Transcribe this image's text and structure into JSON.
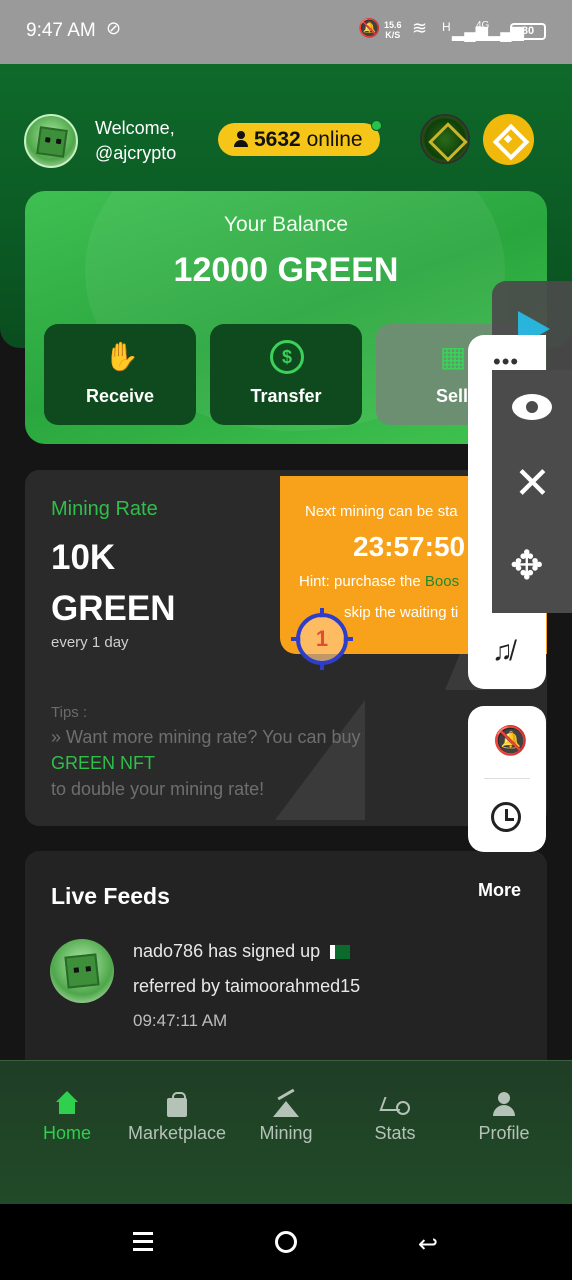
{
  "status_bar": {
    "time": "9:47 AM",
    "net_speed": "15.6",
    "net_unit": "K/S",
    "signal1": "H",
    "signal2": "4G",
    "battery": "80"
  },
  "header": {
    "welcome_line1": "Welcome,",
    "welcome_line2": "@ajcrypto",
    "online_count": "5632",
    "online_label": "online"
  },
  "balance": {
    "label": "Your Balance",
    "value": "12000 GREEN",
    "actions": [
      {
        "label": "Receive",
        "icon": "hand-coins-icon"
      },
      {
        "label": "Transfer",
        "icon": "dollar-transfer-icon"
      },
      {
        "label": "Sell",
        "icon": "store-icon"
      }
    ]
  },
  "mining": {
    "label": "Mining Rate",
    "value_line1": "10K",
    "value_line2": "GREEN",
    "period": "every 1 day",
    "tips_heading": "Tips :",
    "tips_line1": "» Want more mining rate? You can buy",
    "tips_link": "GREEN NFT",
    "tips_line3": "to double your mining rate!",
    "next_title": "Next mining can be sta",
    "timer": "23:57:50",
    "hint_prefix": "Hint: purchase the ",
    "hint_boost": "Boos",
    "hint_line2": "skip the waiting ti",
    "marker_number": "1"
  },
  "feeds": {
    "title": "Live Feeds",
    "more_label": "More",
    "items": [
      {
        "line1": "nado786 has signed up",
        "line2": "referred by taimoorahmed15",
        "time": "09:47:11 AM",
        "flag": "pakistan-flag-icon"
      }
    ]
  },
  "bottom_nav": [
    {
      "label": "Home",
      "active": true
    },
    {
      "label": "Marketplace",
      "active": false
    },
    {
      "label": "Mining",
      "active": false
    },
    {
      "label": "Stats",
      "active": false
    },
    {
      "label": "Profile",
      "active": false
    }
  ],
  "overlay": {
    "more_dots": "•••"
  },
  "colors": {
    "brand_green": "#2fbf4a",
    "accent_yellow": "#f5c518",
    "timer_orange": "#f7a21a"
  }
}
